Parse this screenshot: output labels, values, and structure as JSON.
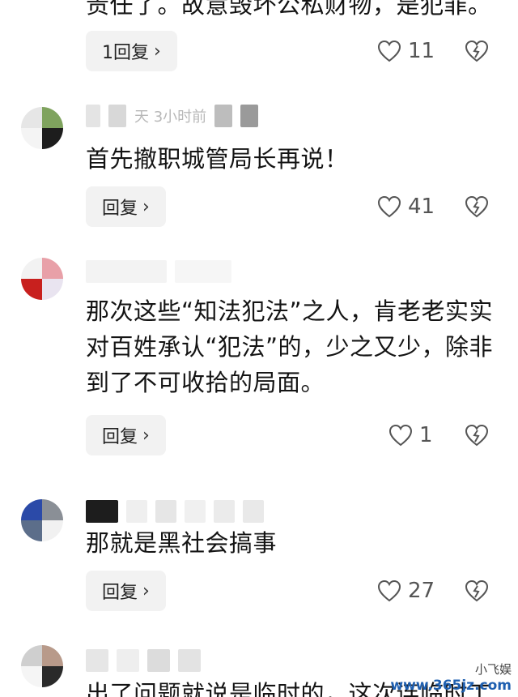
{
  "comments": [
    {
      "text": "责任了。故意毁坏公私财物，是犯罪。",
      "reply_label": "1回复",
      "likes": "11"
    },
    {
      "meta": "天 3小时前",
      "text": "首先撤职城管局长再说！",
      "reply_label": "回复",
      "likes": "41"
    },
    {
      "text": "那次这些“知法犯法”之人，肯老老实实对百姓承认“犯法”的，少之又少，除非到了不可收拾的局面。",
      "reply_label": "回复",
      "likes": "1"
    },
    {
      "text": "那就是黑社会搞事",
      "reply_label": "回复",
      "likes": "27"
    },
    {
      "text": "出了问题就说是临时的，这次连临时工"
    }
  ],
  "watermark": {
    "account": "小飞娱",
    "site": "www.365jz.com"
  },
  "icons": {
    "like": "heart-outline-icon",
    "dislike": "broken-heart-icon",
    "chevron": "chevron-right-icon"
  },
  "colors": {
    "reply_bg": "#f2f2f2",
    "text": "#141414",
    "icon": "#555555",
    "watermark_site": "#1e5fb0"
  }
}
